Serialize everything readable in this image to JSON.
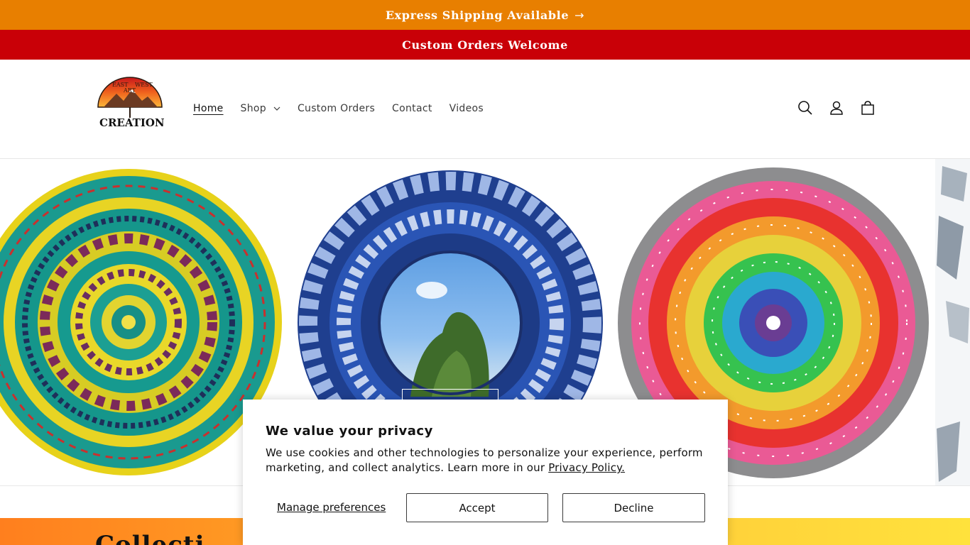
{
  "announcements": {
    "shipping": "Express Shipping Available",
    "custom": "Custom Orders Welcome"
  },
  "logo": {
    "line_east": "EAST",
    "line_west": "WEST",
    "line_art": "ART",
    "line_creations": "CREATIONS"
  },
  "nav": {
    "items": [
      {
        "label": "Home",
        "active": true
      },
      {
        "label": "Shop",
        "has_dropdown": true
      },
      {
        "label": "Custom Orders"
      },
      {
        "label": "Contact"
      },
      {
        "label": "Videos"
      }
    ]
  },
  "header_icons": [
    "search-icon",
    "account-icon",
    "cart-icon"
  ],
  "hero": {
    "slides": [
      "teal-yellow-mandala-plate",
      "blue-mandala-mirror",
      "rainbow-mandala-plate",
      "silver-partial-item"
    ]
  },
  "collections": {
    "title": "Collecti"
  },
  "consent": {
    "title": "We value your privacy",
    "text": "We use cookies and other technologies to personalize your experience, perform marketing, and collect analytics. Learn more in our",
    "link": "Privacy Policy.",
    "manage": "Manage preferences",
    "accept": "Accept",
    "decline": "Decline"
  },
  "colors": {
    "shipping_bar": "#e87f00",
    "custom_bar": "#c90007"
  }
}
